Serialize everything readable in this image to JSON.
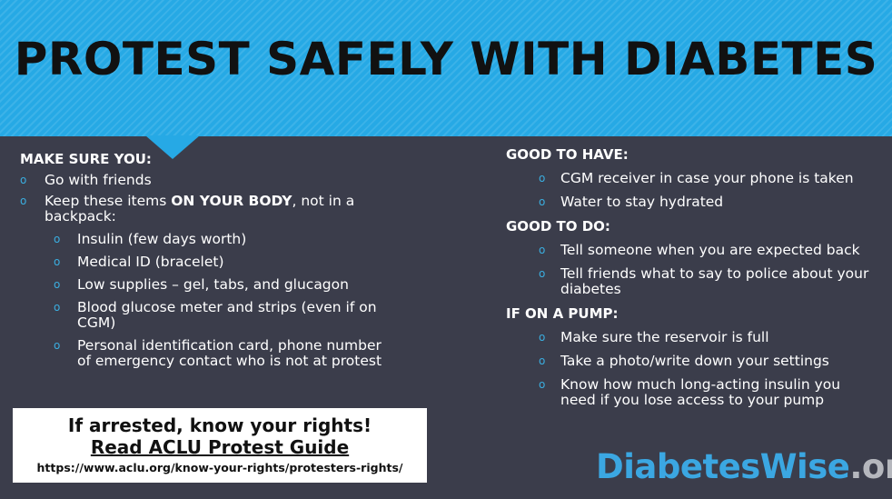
{
  "title": "PROTEST SAFELY WITH DIABETES",
  "left": {
    "heading": "MAKE SURE YOU:",
    "items": [
      {
        "text": "Go with friends"
      },
      {
        "pre": "Keep these items ",
        "bold": "ON YOUR BODY",
        "post": ", not in a backpack:"
      }
    ],
    "subitems": [
      "Insulin (few days worth)",
      "Medical ID (bracelet)",
      "Low supplies – gel, tabs, and glucagon",
      "Blood glucose meter and strips (even if on CGM)",
      "Personal identification card, phone number of emergency contact who is not at protest"
    ]
  },
  "right": {
    "sections": [
      {
        "heading": "GOOD TO HAVE:",
        "items": [
          "CGM receiver in case your phone is taken",
          "Water to stay hydrated"
        ]
      },
      {
        "heading": "GOOD TO DO:",
        "items": [
          "Tell someone when you are expected back",
          "Tell friends what to say to police about your diabetes"
        ]
      },
      {
        "heading": "IF ON A PUMP:",
        "items": [
          "Make sure the reservoir is full",
          "Take a photo/write down your settings",
          "Know how much long-acting insulin you need if you lose access to your pump"
        ]
      }
    ]
  },
  "aclu": {
    "line1": "If arrested, know your rights!",
    "line2": "Read ACLU Protest Guide",
    "url": "https://www.aclu.org/know-your-rights/protesters-rights/"
  },
  "brand": {
    "name": "DiabetesWise",
    "tld": ".org"
  },
  "bullet": "o",
  "colors": {
    "header": "#26a9e5",
    "background": "#3b3d4b",
    "bullet": "#3aaee0",
    "brand_blue": "#3ba7e2",
    "brand_gray": "#b5b7bd"
  }
}
